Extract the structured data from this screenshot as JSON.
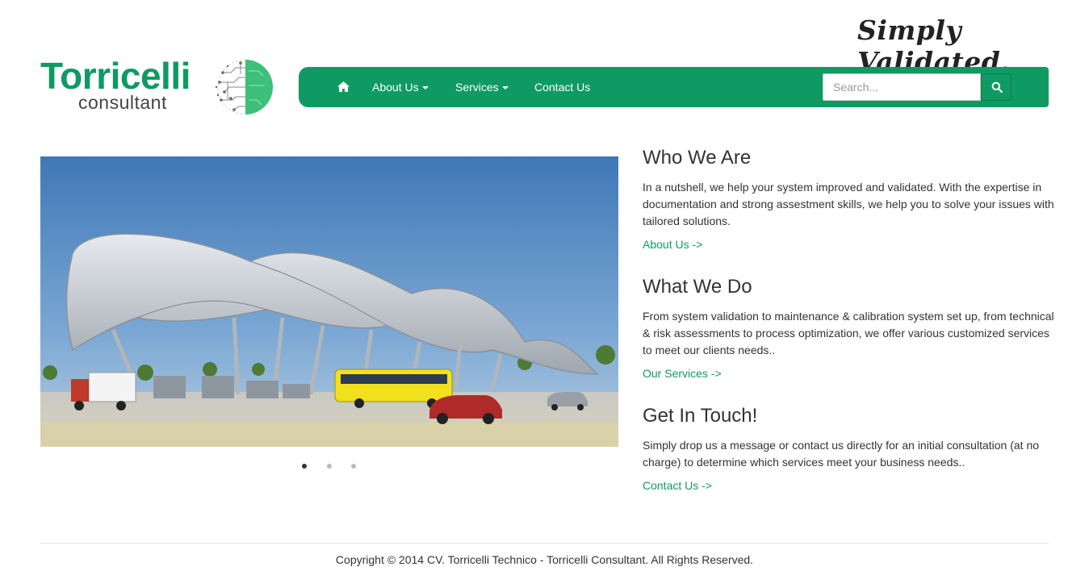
{
  "header": {
    "tagline": "Simply Validated.",
    "logo": {
      "title": "Torricelli",
      "subtitle": "consultant"
    }
  },
  "nav": {
    "home_icon": "home-icon",
    "items": [
      {
        "label": "About Us",
        "dropdown": true
      },
      {
        "label": "Services",
        "dropdown": true
      },
      {
        "label": "Contact Us",
        "dropdown": false
      }
    ],
    "search": {
      "placeholder": "Search...",
      "value": "",
      "icon": "search-icon"
    }
  },
  "carousel": {
    "slides": 3,
    "active_slide": 1
  },
  "sections": [
    {
      "title": "Who We Are",
      "body": "In a nutshell, we help your system improved and validated. With the expertise in documentation and strong assestment skills, we help you to solve your issues with tailored solutions.",
      "link": "About Us ->"
    },
    {
      "title": "What We Do",
      "body": "From system validation to maintenance & calibration system set up, from technical & risk assessments to process optimization, we offer various customized services to meet our clients needs..",
      "link": "Our Services ->"
    },
    {
      "title": "Get In Touch!",
      "body": "Simply drop us a message or contact us directly for an initial consultation (at no charge) to determine which services meet your business needs..",
      "link": "Contact Us ->"
    }
  ],
  "footer": {
    "copyright": "Copyright © 2014 CV. Torricelli Technico - Torricelli Consultant. All Rights Reserved."
  },
  "colors": {
    "brand_green": "#0f9a63",
    "text": "#333333",
    "sky": "#5d8fc2"
  }
}
